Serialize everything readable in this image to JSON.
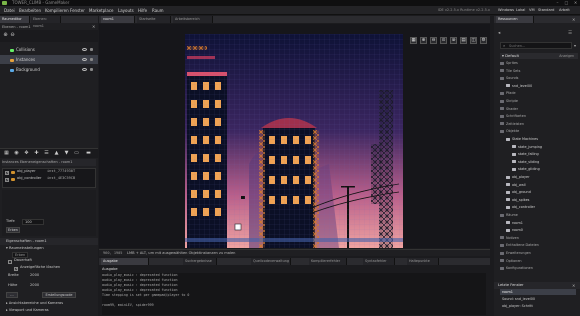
{
  "window": {
    "title": "TOWER_CLIMB - GameMaker",
    "version": "IDE v2.2.5.x Runtime v2.2.5.x"
  },
  "menubar": {
    "items": [
      "Datei",
      "Bearbeiten",
      "Kompilieren",
      "Fenster",
      "Marketplace",
      "Layouts",
      "Hilfe",
      "Raum"
    ]
  },
  "workspace_tabs": [
    "Windows",
    "Lokal",
    "VM",
    "Standard",
    "Arbeit"
  ],
  "left": {
    "tabs": [
      "Raumeditor",
      "Ebenen: room1"
    ],
    "layers_header": "Ebenen - room1",
    "layers": [
      "Collisions",
      "Instances",
      "Background"
    ],
    "inst_header": "Instances Ebeneneigenschaften - room1",
    "instances": [
      {
        "name": "obj_player",
        "id": "inst_7774930T"
      },
      {
        "name": "obj_controller",
        "id": "inst_4E3C59CB"
      }
    ],
    "order_label": "Tiefe",
    "order_value": "100",
    "props_header": "Eigenschaften - room1",
    "props_sub": "Raumeinstellungen",
    "parent_field": "Erben",
    "persistent_label": "Dauerhaft",
    "creation_label": "Anzeigefläche löschen",
    "width_label": "Breite",
    "width_value": "2000",
    "height_label": "Höhe",
    "height_value": "2000",
    "creation_code_btn": "Erstellungscode",
    "viewports_label": "Ansichtsbereiche und Kameras",
    "extra_label": "Viewport und Kameras"
  },
  "room_tabs": [
    "room1",
    "Startseite",
    "Arbeitsbereich"
  ],
  "statusbar": {
    "coords": "960, 1905",
    "hint": "LMB + ALT, um mit ausgewählten Objektinstanzen zu malen"
  },
  "output": {
    "tabs": [
      "Ausgabe",
      "Suchergebnisse",
      "Quellcodeverwaltung",
      "Kompiliererfehler",
      "Syntaxfehler",
      "Haltepunkte"
    ],
    "title": "Ausgabe",
    "lines": [
      "audio_play_music : deprecated function",
      "audio_play_music : deprecated function",
      "audio_play_music : deprecated function",
      "audio_play_music : deprecated function",
      "Time stepping is set per gamepad/player to 0",
      "",
      "room99, mainLEV, spider999"
    ]
  },
  "right": {
    "header": "Ressourcen",
    "search_placeholder": "Suchen...",
    "default_label": "Default",
    "group_name": "Anzeigen",
    "tree": [
      {
        "label": "Sprites",
        "level": 0
      },
      {
        "label": "Tile Sets",
        "level": 0
      },
      {
        "label": "Sounds",
        "level": 0
      },
      {
        "label": "snd_level00",
        "level": 1
      },
      {
        "label": "Pfade",
        "level": 0
      },
      {
        "label": "Skripte",
        "level": 0
      },
      {
        "label": "Shader",
        "level": 0
      },
      {
        "label": "Schriftarten",
        "level": 0
      },
      {
        "label": "Zeitleisten",
        "level": 0
      },
      {
        "label": "Objekte",
        "level": 0
      },
      {
        "label": "State Machines",
        "level": 1
      },
      {
        "label": "state_jumping",
        "level": 2
      },
      {
        "label": "state_falling",
        "level": 2
      },
      {
        "label": "state_sliding",
        "level": 2
      },
      {
        "label": "state_gliding",
        "level": 2
      },
      {
        "label": "obj_player",
        "level": 1
      },
      {
        "label": "obj_wall",
        "level": 1
      },
      {
        "label": "obj_ground",
        "level": 1
      },
      {
        "label": "obj_spikes",
        "level": 1
      },
      {
        "label": "obj_controller",
        "level": 1
      },
      {
        "label": "Räume",
        "level": 0
      },
      {
        "label": "room1",
        "level": 1
      },
      {
        "label": "room0",
        "level": 1
      },
      {
        "label": "Notizen",
        "level": 0
      },
      {
        "label": "Enthaltene Dateien",
        "level": 0
      },
      {
        "label": "Erweiterungen",
        "level": 0
      },
      {
        "label": "Optionen",
        "level": 0
      },
      {
        "label": "Konfigurationen",
        "level": 0
      }
    ],
    "recent_header": "Letzte Fenster",
    "recent": [
      "room1",
      "Sound: snd_level00",
      "obj_player: Schritt"
    ]
  }
}
